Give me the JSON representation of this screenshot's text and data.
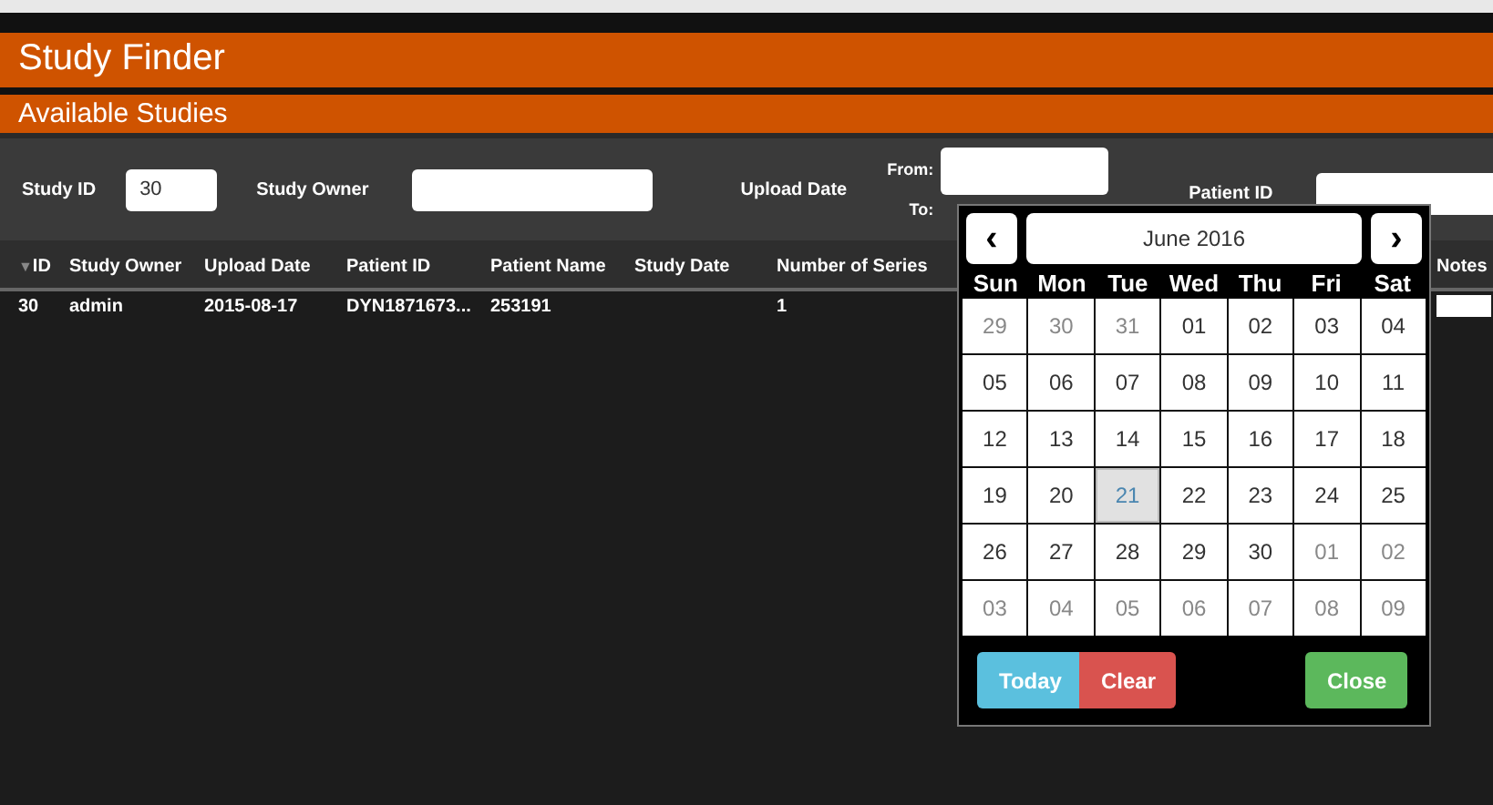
{
  "header": {
    "title": "Study Finder",
    "subtitle": "Available Studies"
  },
  "filters": {
    "study_id_label": "Study ID",
    "study_id_value": "30",
    "study_owner_label": "Study Owner",
    "upload_date_label": "Upload Date",
    "from_label": "From:",
    "to_label": "To:",
    "patient_id_label": "Patient ID"
  },
  "table": {
    "sort_icon": "▼",
    "columns": [
      "ID",
      "Study Owner",
      "Upload Date",
      "Patient ID",
      "Patient Name",
      "Study Date",
      "Number of Series",
      "Notes"
    ],
    "rows": [
      {
        "cells": [
          "30",
          "admin",
          "2015-08-17",
          "DYN1871673...",
          "253191",
          "",
          "1"
        ]
      }
    ]
  },
  "calendar": {
    "prev": "‹",
    "next": "›",
    "month": "June 2016",
    "weekdays": [
      "Sun",
      "Mon",
      "Tue",
      "Wed",
      "Thu",
      "Fri",
      "Sat"
    ],
    "days": [
      {
        "label": "29",
        "other_month": true,
        "selected": false
      },
      {
        "label": "30",
        "other_month": true,
        "selected": false
      },
      {
        "label": "31",
        "other_month": true,
        "selected": false
      },
      {
        "label": "01",
        "other_month": false,
        "selected": false
      },
      {
        "label": "02",
        "other_month": false,
        "selected": false
      },
      {
        "label": "03",
        "other_month": false,
        "selected": false
      },
      {
        "label": "04",
        "other_month": false,
        "selected": false
      },
      {
        "label": "05",
        "other_month": false,
        "selected": false
      },
      {
        "label": "06",
        "other_month": false,
        "selected": false
      },
      {
        "label": "07",
        "other_month": false,
        "selected": false
      },
      {
        "label": "08",
        "other_month": false,
        "selected": false
      },
      {
        "label": "09",
        "other_month": false,
        "selected": false
      },
      {
        "label": "10",
        "other_month": false,
        "selected": false
      },
      {
        "label": "11",
        "other_month": false,
        "selected": false
      },
      {
        "label": "12",
        "other_month": false,
        "selected": false
      },
      {
        "label": "13",
        "other_month": false,
        "selected": false
      },
      {
        "label": "14",
        "other_month": false,
        "selected": false
      },
      {
        "label": "15",
        "other_month": false,
        "selected": false
      },
      {
        "label": "16",
        "other_month": false,
        "selected": false
      },
      {
        "label": "17",
        "other_month": false,
        "selected": false
      },
      {
        "label": "18",
        "other_month": false,
        "selected": false
      },
      {
        "label": "19",
        "other_month": false,
        "selected": false
      },
      {
        "label": "20",
        "other_month": false,
        "selected": false
      },
      {
        "label": "21",
        "other_month": false,
        "selected": true
      },
      {
        "label": "22",
        "other_month": false,
        "selected": false
      },
      {
        "label": "23",
        "other_month": false,
        "selected": false
      },
      {
        "label": "24",
        "other_month": false,
        "selected": false
      },
      {
        "label": "25",
        "other_month": false,
        "selected": false
      },
      {
        "label": "26",
        "other_month": false,
        "selected": false
      },
      {
        "label": "27",
        "other_month": false,
        "selected": false
      },
      {
        "label": "28",
        "other_month": false,
        "selected": false
      },
      {
        "label": "29",
        "other_month": false,
        "selected": false
      },
      {
        "label": "30",
        "other_month": false,
        "selected": false
      },
      {
        "label": "01",
        "other_month": true,
        "selected": false
      },
      {
        "label": "02",
        "other_month": true,
        "selected": false
      },
      {
        "label": "03",
        "other_month": true,
        "selected": false
      },
      {
        "label": "04",
        "other_month": true,
        "selected": false
      },
      {
        "label": "05",
        "other_month": true,
        "selected": false
      },
      {
        "label": "06",
        "other_month": true,
        "selected": false
      },
      {
        "label": "07",
        "other_month": true,
        "selected": false
      },
      {
        "label": "08",
        "other_month": true,
        "selected": false
      },
      {
        "label": "09",
        "other_month": true,
        "selected": false
      }
    ],
    "buttons": [
      {
        "label": "Today",
        "kind": "info"
      },
      {
        "label": "Clear",
        "kind": "danger"
      },
      {
        "label": "Close",
        "kind": "success"
      }
    ]
  }
}
